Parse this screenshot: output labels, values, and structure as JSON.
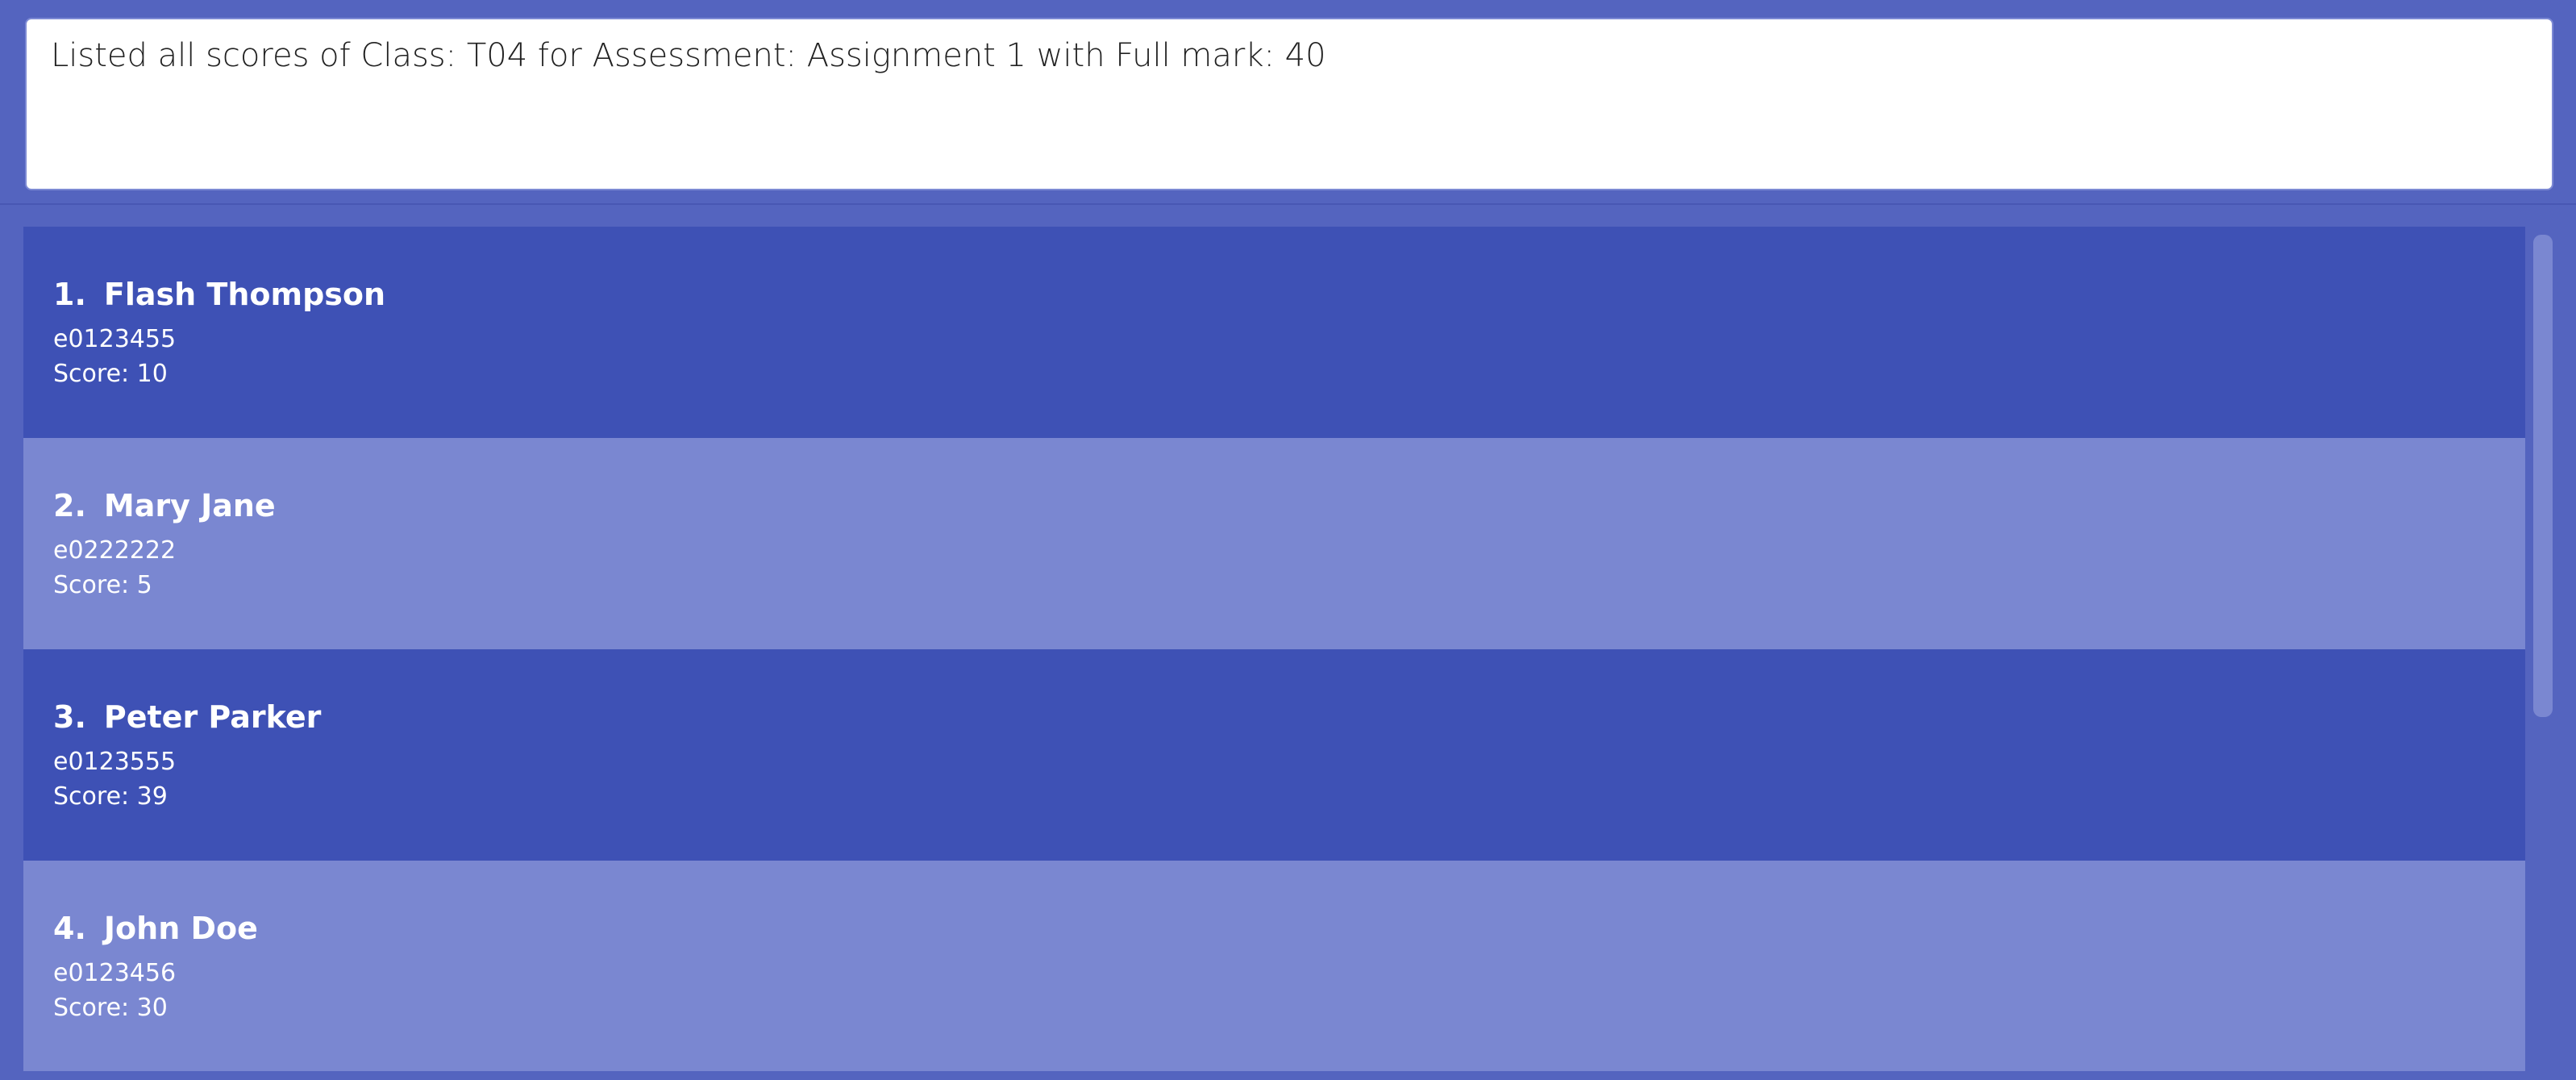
{
  "result_display": {
    "text": "Listed all scores of Class: T04 for Assessment: Assignment 1 with Full mark: 40"
  },
  "students": [
    {
      "index": "1.",
      "name": "Flash Thompson",
      "id": "e0123455",
      "score": "Score: 10"
    },
    {
      "index": "2.",
      "name": "Mary Jane",
      "id": "e0222222",
      "score": "Score: 5"
    },
    {
      "index": "3.",
      "name": "Peter Parker",
      "id": "e0123555",
      "score": "Score: 39"
    },
    {
      "index": "4.",
      "name": "John Doe",
      "id": "e0123456",
      "score": "Score: 30"
    }
  ],
  "colors": {
    "background": "#5464bf",
    "card_dark": "#3e51b5",
    "card_light": "#7a87d1",
    "result_box": "#ffffff"
  }
}
